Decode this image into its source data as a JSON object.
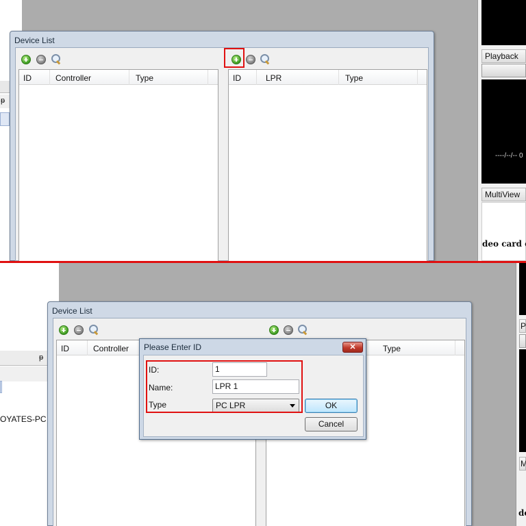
{
  "top": {
    "device_list": {
      "title": "Device List",
      "left_list": {
        "columns": [
          "ID",
          "Controller",
          "Type"
        ]
      },
      "right_list": {
        "columns": [
          "ID",
          "LPR",
          "Type"
        ]
      }
    },
    "side": {
      "playback_label": "Playback",
      "video_time": "----/--/-- 0",
      "multiview_label": "MultiView",
      "video_card_text": "deo card co"
    },
    "left_pin": "ᵽ"
  },
  "bottom": {
    "device_list": {
      "title": "Device List",
      "left_list": {
        "columns": [
          "ID",
          "Controller"
        ]
      },
      "right_list": {
        "columns": [
          "Type"
        ]
      }
    },
    "left_panel": {
      "computer_name": "OYATES-PC",
      "pin": "ᵽ"
    },
    "side": {
      "p_label": "P",
      "m_label": "M",
      "de_label": "de"
    },
    "dialog": {
      "title": "Please Enter ID",
      "id_label": "ID:",
      "id_value": "1",
      "name_label": "Name:",
      "name_value": "LPR 1",
      "type_label": "Type",
      "type_value": "PC LPR",
      "ok_label": "OK",
      "cancel_label": "Cancel"
    }
  },
  "colors": {
    "highlight": "#e01010",
    "workspace": "#acacac"
  },
  "icons": [
    "add-icon",
    "remove-icon",
    "search-icon",
    "pin-icon",
    "close-icon",
    "dropdown-arrow-icon"
  ]
}
